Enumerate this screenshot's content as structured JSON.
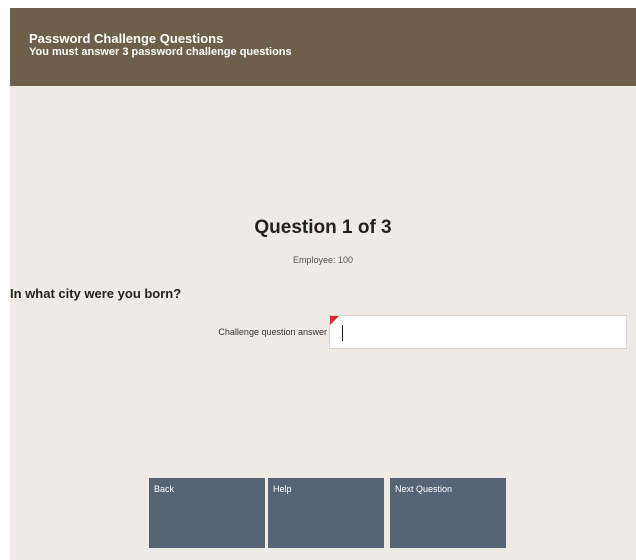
{
  "header": {
    "title": "Password Challenge Questions",
    "subtitle": "You must answer 3 password challenge questions"
  },
  "main": {
    "heading": "Question 1 of 3",
    "employee": "Employee: 100",
    "question": "In what city were you born?",
    "answer_label": "Challenge question answer",
    "answer_value": ""
  },
  "buttons": {
    "back": "Back",
    "help": "Help",
    "next": "Next Question"
  },
  "colors": {
    "header_bg": "#6e5f4b",
    "body_bg": "#eeebe7",
    "button_bg": "#566476",
    "required_flag": "#e0282a"
  }
}
